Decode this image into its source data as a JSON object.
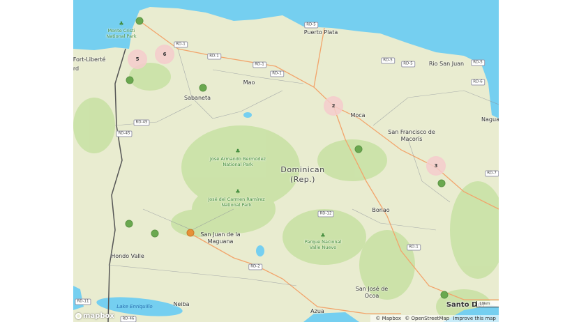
{
  "map": {
    "colors": {
      "water": "#75cff0",
      "land": "#e9ecd0",
      "park": "#c9e2a5",
      "road": "#f2a46b",
      "border": "#555555",
      "point": "#6aa84f",
      "point_highlight": "#e69138",
      "cluster": "#f4cccc"
    },
    "places": [
      {
        "name": "Puerto Plata"
      },
      {
        "name": "Fort-Liberté"
      },
      {
        "name": "rd"
      },
      {
        "name": "Mao"
      },
      {
        "name": "Sabaneta"
      },
      {
        "name": "Moca"
      },
      {
        "name": "San Francisco de Macorís"
      },
      {
        "name": "Rio San Juan"
      },
      {
        "name": "Nagua"
      },
      {
        "name": "Bonao"
      },
      {
        "name": "San Juan de la Maguana"
      },
      {
        "name": "Hondo Valle"
      },
      {
        "name": "Neiba"
      },
      {
        "name": "Azua"
      },
      {
        "name": "San José de Ocoa"
      },
      {
        "name": "Santo Dor"
      }
    ],
    "country_label": "Dominican (Rep.)",
    "parks": [
      {
        "name": "Monte Cristi National Park"
      },
      {
        "name": "José Armando Bermúdez National Park"
      },
      {
        "name": "José del Carmen Ramírez National Park"
      },
      {
        "name": "Parque Nacional Valle Nuevo"
      }
    ],
    "water_labels": [
      {
        "name": "Lake Enriquillo"
      }
    ],
    "road_shields": [
      "RD-5",
      "RD-1",
      "RD-1",
      "RD-1",
      "RD-1",
      "RD-5",
      "RD-5",
      "RD-5",
      "RD-6",
      "RD-45",
      "RD-45",
      "RD-12",
      "RD-2",
      "RD-1",
      "RD-7",
      "RD-11",
      "RD-46"
    ],
    "clusters": [
      {
        "count": "5"
      },
      {
        "count": "6"
      },
      {
        "count": "2"
      },
      {
        "count": "3"
      }
    ],
    "scale": "10km",
    "attribution": {
      "mapbox": "© Mapbox",
      "osm": "© OpenStreetMap",
      "improve": "Improve this map"
    },
    "logo": "mapbox"
  }
}
